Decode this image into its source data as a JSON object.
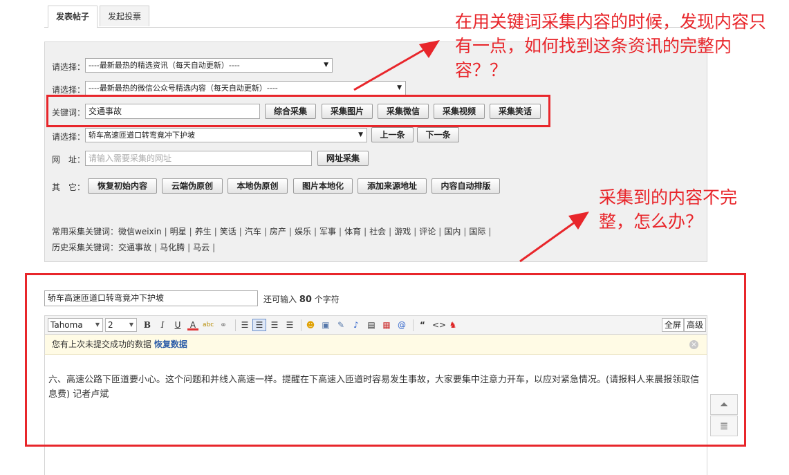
{
  "tabs": [
    {
      "label": "发表帖子",
      "active": true
    },
    {
      "label": "发起投票",
      "active": false
    }
  ],
  "collect": {
    "select1": {
      "label": "请选择：",
      "value": "----最新最热的精选资讯（每天自动更新）----"
    },
    "select2": {
      "label": "请选择：",
      "value": "----最新最热的微信公众号精选内容（每天自动更新）----"
    },
    "keyword": {
      "label": "关键词：",
      "value": "交通事故",
      "buttons": [
        "综合采集",
        "采集图片",
        "采集微信",
        "采集视频",
        "采集笑话"
      ]
    },
    "select3": {
      "label": "请选择：",
      "value": "轿车高速匝道口转弯竟冲下护坡",
      "prev": "上一条",
      "next": "下一条"
    },
    "url": {
      "label": "网　址：",
      "placeholder": "请输入需要采集的网址",
      "button": "网址采集"
    },
    "other": {
      "label": "其　它：",
      "buttons": [
        "恢复初始内容",
        "云端伪原创",
        "本地伪原创",
        "图片本地化",
        "添加来源地址",
        "内容自动排版"
      ]
    },
    "common_keywords": {
      "label": "常用采集关键词：",
      "items": [
        "微信weixin",
        "明星",
        "养生",
        "笑话",
        "汽车",
        "房产",
        "娱乐",
        "军事",
        "体育",
        "社会",
        "游戏",
        "评论",
        "国内",
        "国际"
      ]
    },
    "history_keywords": {
      "label": "历史采集关键词：",
      "items": [
        "交通事故",
        "马化腾",
        "马云"
      ]
    }
  },
  "editor": {
    "title_value": "轿车高速匝道口转弯竟冲下护坡",
    "hint_prefix": "还可输入",
    "hint_count": "80",
    "hint_suffix": "个字符",
    "font_family": "Tahoma",
    "font_size": "2",
    "fullscreen": "全屏",
    "advanced": "高级",
    "notice_text": "您有上次未提交成功的数据",
    "notice_link": "恢复数据",
    "content": "六、高速公路下匝道要小心。这个问题和并线入高速一样。提醒在下高速入匝道时容易发生事故，大家要集中注意力开车，以应对紧急情况。(请报料人来晨报领取信息费) 记者卢斌"
  },
  "annotations": {
    "note1": "在用关键词采集内容的时候，发现内容只有一点，如何找到这条资讯的完整内容？？",
    "note2": "采集到的内容不完整，怎么办？",
    "color": "#e8262b"
  }
}
